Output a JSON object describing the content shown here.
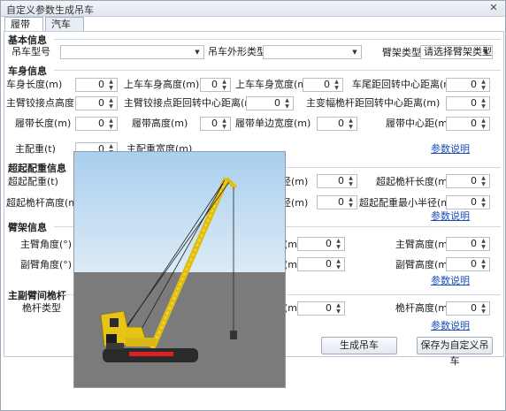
{
  "window": {
    "title": "自定义参数生成吊车",
    "close": "✕"
  },
  "tabs": [
    "履带吊",
    "汽车吊"
  ],
  "sections": {
    "basic": "基本信息",
    "body": "车身信息",
    "super": "超起配重信息",
    "boom": "臂架信息",
    "mast": "主副臂间桅杆"
  },
  "basic": {
    "model_label": "吊车型号",
    "shape_label": "吊车外形类型",
    "boom_type_label": "臂架类型",
    "boom_type_value": "请选择臂架类型"
  },
  "body": {
    "fields": [
      {
        "label": "车身长度(m)",
        "value": "0"
      },
      {
        "label": "上车车身高度(m)",
        "value": "0"
      },
      {
        "label": "上车车身宽度(m)",
        "value": "0"
      },
      {
        "label": "车尾距回转中心距离(m)",
        "value": "0"
      },
      {
        "label": "主臂铰接点高度(m)",
        "value": "0"
      },
      {
        "label": "主臂铰接点距回转中心距离(m)",
        "value": "0"
      },
      {
        "label": "主变幅桅杆距回转中心距离(m)",
        "value": "0"
      },
      {
        "label": "履带长度(m)",
        "value": "0"
      },
      {
        "label": "履带高度(m)",
        "value": "0"
      },
      {
        "label": "履带单边宽度(m)",
        "value": "0"
      },
      {
        "label": "履带中心距(m)",
        "value": "0"
      },
      {
        "label": "主配重(t)",
        "value": "0"
      },
      {
        "label": "主配重宽度(m)",
        "value": "0"
      }
    ],
    "params_link": "参数说明"
  },
  "super": {
    "fields": [
      {
        "label": "超起配重(t)",
        "value": "0"
      },
      {
        "label": "半径(m)",
        "value": "0"
      },
      {
        "label": "超起桅杆长度(m)",
        "value": "0"
      },
      {
        "label": "超起桅杆高度(m)",
        "value": "0"
      },
      {
        "label": "半径(m)",
        "value": "0"
      },
      {
        "label": "超起配重最小半径(m)",
        "value": "0"
      }
    ],
    "params_link": "参数说明"
  },
  "boom": {
    "fields": [
      {
        "label": "主臂角度(°)",
        "value": "0"
      },
      {
        "label": "(m)",
        "value": "0"
      },
      {
        "label": "主臂高度(m)",
        "value": "0"
      },
      {
        "label": "副臂角度(°)",
        "value": "0"
      },
      {
        "label": "(m)",
        "value": "0"
      },
      {
        "label": "副臂高度(m)",
        "value": "0"
      }
    ],
    "params_link": "参数说明"
  },
  "mast": {
    "fields": [
      {
        "label": "桅杆类型",
        "value": ""
      },
      {
        "label": "(m)",
        "value": "0"
      },
      {
        "label": "桅杆高度(m)",
        "value": "0"
      }
    ],
    "params_link": "参数说明"
  },
  "buttons": {
    "generate": "生成吊车",
    "save": "保存为自定义吊车"
  },
  "colors": {
    "sky": "#bcd8ee",
    "ground": "#7a7a7a",
    "crane": "#f2d21b",
    "tracks": "#2b2b2b"
  }
}
